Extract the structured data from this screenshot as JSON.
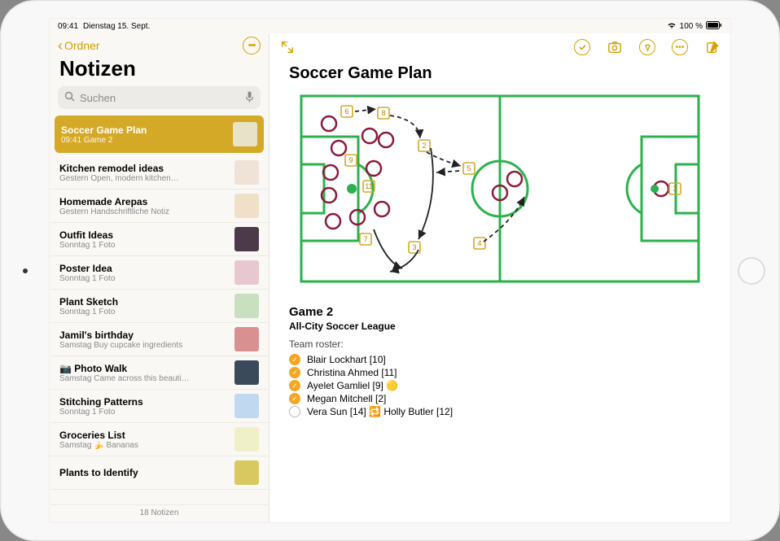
{
  "status": {
    "time": "09:41",
    "date": "Dienstag 15. Sept.",
    "battery": "100 %",
    "wifi": "􀙇"
  },
  "sidebar": {
    "back_label": "Ordner",
    "title": "Notizen",
    "search_placeholder": "Suchen",
    "footer": "18 Notizen",
    "notes": [
      {
        "title": "Soccer Game Plan",
        "sub": "09:41  Game 2",
        "selected": true
      },
      {
        "title": "Kitchen remodel ideas",
        "sub": "Gestern  Open, modern kitchen…"
      },
      {
        "title": "Homemade Arepas",
        "sub": "Gestern  Handschriftliche Notiz"
      },
      {
        "title": "Outfit Ideas",
        "sub": "Sonntag  1 Foto"
      },
      {
        "title": "Poster Idea",
        "sub": "Sonntag  1 Foto"
      },
      {
        "title": "Plant Sketch",
        "sub": "Sonntag  1 Foto"
      },
      {
        "title": "Jamil's birthday",
        "sub": "Samstag  Buy cupcake ingredients"
      },
      {
        "title": "📷  Photo Walk",
        "sub": "Samstag  Came across this beauti…"
      },
      {
        "title": "Stitching Patterns",
        "sub": "Sonntag  1 Foto"
      },
      {
        "title": "Groceries List",
        "sub": "Samstag  🍌 Bananas"
      },
      {
        "title": "Plants to Identify",
        "sub": ""
      }
    ]
  },
  "content": {
    "title": "Soccer Game Plan",
    "game_heading": "Game 2",
    "league": "All-City Soccer League",
    "roster_label": "Team roster:",
    "roster": [
      {
        "name": "Blair Lockhart [10]",
        "checked": true,
        "extra": ""
      },
      {
        "name": "Christina Ahmed [11]",
        "checked": true,
        "extra": ""
      },
      {
        "name": "Ayelet Gamliel [9]",
        "checked": true,
        "extra": "🟡"
      },
      {
        "name": "Megan Mitchell [2]",
        "checked": true,
        "extra": ""
      },
      {
        "name": "Vera Sun [14]",
        "checked": false,
        "extra": "🔁 Holly Butler [12]"
      }
    ]
  },
  "thumbs": [
    "#e8e2c8",
    "#efe3d8",
    "#f0e0c8",
    "#4a3a4a",
    "#e8c8d0",
    "#c8e0c0",
    "#d89090",
    "#3a4a5a",
    "#c0d8f0",
    "#f0f0c8",
    "#d8c860"
  ],
  "colors": {
    "accent": "#d5a100"
  }
}
